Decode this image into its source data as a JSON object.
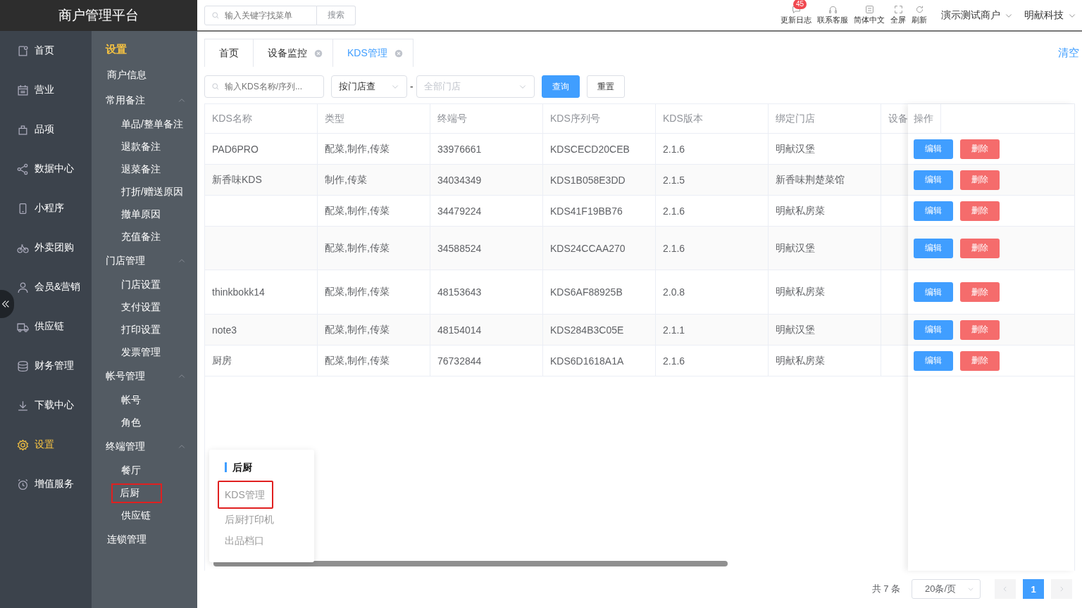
{
  "brand": "商户管理平台",
  "nav": [
    {
      "label": "首页",
      "selected": false
    },
    {
      "label": "营业",
      "selected": false
    },
    {
      "label": "品项",
      "selected": false
    },
    {
      "label": "数据中心",
      "selected": false
    },
    {
      "label": "小程序",
      "selected": false
    },
    {
      "label": "外卖团购",
      "selected": false
    },
    {
      "label": "会员&营销",
      "selected": false
    },
    {
      "label": "供应链",
      "selected": false
    },
    {
      "label": "财务管理",
      "selected": false
    },
    {
      "label": "下载中心",
      "selected": false
    },
    {
      "label": "设置",
      "selected": true
    },
    {
      "label": "增值服务",
      "selected": false
    }
  ],
  "submenu": {
    "title": "设置",
    "items": [
      {
        "label": "商户信息",
        "highlighted": false
      },
      {
        "label": "常用备注",
        "expanded": true,
        "children": [
          {
            "label": "单品/整单备注",
            "highlighted": false
          },
          {
            "label": "退款备注",
            "highlighted": false
          },
          {
            "label": "退菜备注",
            "highlighted": false
          },
          {
            "label": "打折/赠送原因",
            "highlighted": false
          },
          {
            "label": "撤单原因",
            "highlighted": false
          },
          {
            "label": "充值备注",
            "highlighted": false
          }
        ]
      },
      {
        "label": "门店管理",
        "expanded": true,
        "children": [
          {
            "label": "门店设置",
            "highlighted": false
          },
          {
            "label": "支付设置",
            "highlighted": false
          },
          {
            "label": "打印设置",
            "highlighted": false
          },
          {
            "label": "发票管理",
            "highlighted": false
          }
        ]
      },
      {
        "label": "帐号管理",
        "expanded": true,
        "children": [
          {
            "label": "帐号",
            "highlighted": false
          },
          {
            "label": "角色",
            "highlighted": false
          }
        ]
      },
      {
        "label": "终端管理",
        "expanded": true,
        "children": [
          {
            "label": "餐厅",
            "highlighted": false
          },
          {
            "label": "后厨",
            "highlighted": true
          },
          {
            "label": "供应链",
            "highlighted": false
          }
        ]
      },
      {
        "label": "连锁管理",
        "highlighted": false
      }
    ]
  },
  "header": {
    "search": {
      "placeholder": "输入关键字找菜单",
      "button": "搜索"
    },
    "tools": [
      {
        "label": "更新日志",
        "badge": "45"
      },
      {
        "label": "联系客服"
      },
      {
        "label": "简体中文"
      },
      {
        "label": "全屏"
      },
      {
        "label": "刷新"
      }
    ],
    "menus": [
      "演示测试商户",
      "明献科技"
    ]
  },
  "tabs": [
    {
      "label": "首页",
      "closable": false,
      "selected": false
    },
    {
      "label": "设备监控",
      "closable": true,
      "selected": false
    },
    {
      "label": "KDS管理",
      "closable": true,
      "selected": true
    }
  ],
  "clear_link": "清空",
  "filters": {
    "search": {
      "placeholder": "输入KDS名称/序列..."
    },
    "mode": {
      "value": "按门店查"
    },
    "separator": "-",
    "store": {
      "placeholder": "全部门店"
    },
    "query_button": "查询",
    "reset_button": "重置"
  },
  "table": {
    "columns": [
      "KDS名称",
      "类型",
      "终端号",
      "KDS序列号",
      "KDS版本",
      "绑定门店",
      "设备",
      "操作"
    ],
    "rows": [
      {
        "cells": [
          "PAD6PRO",
          "配菜,制作,传菜",
          "33976661",
          "KDSCECD20CEB",
          "2.1.6",
          "明献汉堡",
          ""
        ],
        "actions": [
          "编辑",
          "删除"
        ]
      },
      {
        "cells": [
          "新香味KDS",
          "制作,传菜",
          "34034349",
          "KDS1B058E3DD",
          "2.1.5",
          "新香味荆楚菜馆",
          ""
        ],
        "actions": [
          "编辑",
          "删除"
        ]
      },
      {
        "cells": [
          "",
          "配菜,制作,传菜",
          "34479224",
          "KDS41F19BB76",
          "2.1.6",
          "明献私房菜",
          ""
        ],
        "actions": [
          "编辑",
          "删除"
        ]
      },
      {
        "cells": [
          "",
          "配菜,制作,传菜",
          "34588524",
          "KDS24CCAA270",
          "2.1.6",
          "明献汉堡",
          ""
        ],
        "actions": [
          "编辑",
          "删除"
        ]
      },
      {
        "cells": [
          "thinkbokk14",
          "配菜,制作,传菜",
          "48153643",
          "KDS6AF88925B",
          "2.0.8",
          "明献私房菜",
          ""
        ],
        "actions": [
          "编辑",
          "删除"
        ]
      },
      {
        "cells": [
          "note3",
          "配菜,制作,传菜",
          "48154014",
          "KDS284B3C05E",
          "2.1.1",
          "明献汉堡",
          ""
        ],
        "actions": [
          "编辑",
          "删除"
        ]
      },
      {
        "cells": [
          "厨房",
          "配菜,制作,传菜",
          "76732844",
          "KDS6D1618A1A",
          "2.1.6",
          "明献私房菜",
          ""
        ],
        "actions": [
          "编辑",
          "删除"
        ]
      }
    ]
  },
  "popover": {
    "title": "后厨",
    "items": [
      {
        "label": "KDS管理",
        "highlighted": true
      },
      {
        "label": "后厨打印机",
        "highlighted": false
      },
      {
        "label": "出品档口",
        "highlighted": false
      }
    ]
  },
  "pagination": {
    "total": "共 7 条",
    "page_size": "20条/页",
    "pages": [
      {
        "label": "1",
        "selected": true
      }
    ]
  }
}
